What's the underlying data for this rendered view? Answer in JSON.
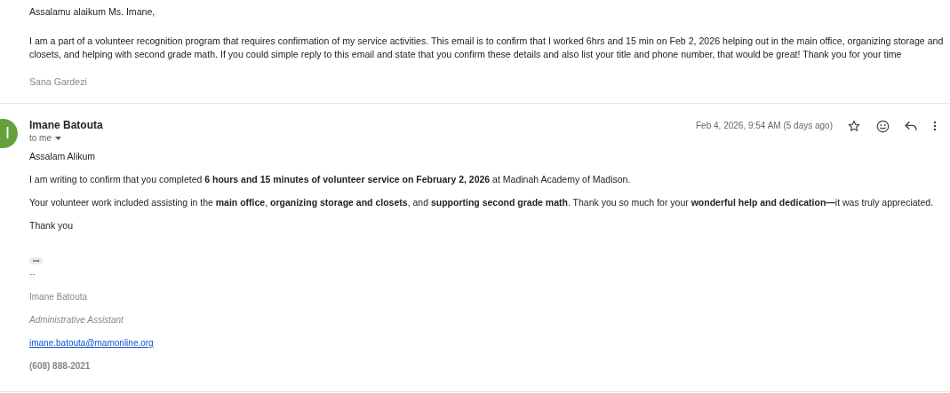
{
  "previous_message": {
    "greeting": "Assalamu alaikum Ms. Imane,",
    "body": "I am a part of a volunteer recognition program that requires confirmation of my service activities. This email is to confirm that I worked 6hrs and 15 min on Feb 2, 2026 helping out in the main office, organizing storage and closets, and helping with second grade math. If you could simple reply to this email and state that you confirm these details and also list your title and phone number, that would be great! Thank you for your time",
    "signature": "Sana Gardezi"
  },
  "message": {
    "avatar_letter": "I",
    "sender": "Imane Batouta",
    "recipient": "to me",
    "date": "Feb 4, 2026, 9:54 AM (5 days ago)",
    "starred": false,
    "paragraphs": [
      "Assalam Alikum",
      "I am writing to confirm that you completed **6 hours and 15 minutes of volunteer service on February 2, 2026** at Madinah Academy of Madison.",
      "Your volunteer work included assisting in the **main office**, **organizing storage and closets**, and **supporting second grade math**. Thank you so much for your **wonderful help and dedication—**it was truly appreciated.",
      "Thank you"
    ],
    "trimmed_content": "•••",
    "signature": [
      {
        "kind": "separator",
        "text": "--"
      },
      {
        "kind": "name",
        "text": "Imane Batouta"
      },
      {
        "kind": "title",
        "text": "Administrative Assistant"
      },
      {
        "kind": "email",
        "text": "imane.batouta@mamonline.org"
      },
      {
        "kind": "phone",
        "text": "(608) 888-2021"
      }
    ]
  }
}
